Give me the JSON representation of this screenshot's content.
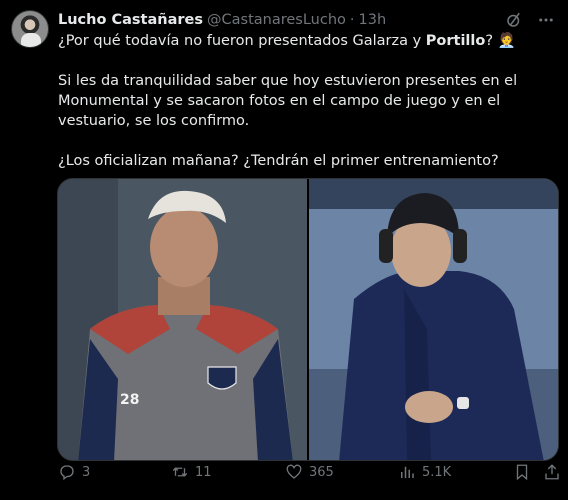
{
  "author": {
    "name": "Lucho Castañares",
    "handle": "@CastanaresLucho",
    "separator": "·",
    "time": "13h"
  },
  "tweet": {
    "line1_prefix": "¿Por qué todavía no fueron presentados Galarza y ",
    "line1_bold": "Portillo",
    "line1_suffix": "? 🧑‍💼",
    "paragraph2": "Si les da tranquilidad saber que hoy estuvieron presentes en el Monumental y se sacaron fotos en el campo de juego y en el vestuario, se los confirmo.",
    "paragraph3": "¿Los oficializan mañana? ¿Tendrán el primer entrenamiento?"
  },
  "media": {
    "left_jersey_number": "28"
  },
  "actions": {
    "replies": "3",
    "retweets": "11",
    "likes": "365",
    "views": "5.1K"
  },
  "colors": {
    "background": "#000000",
    "text": "#e7e9ea",
    "muted": "#71767b"
  }
}
